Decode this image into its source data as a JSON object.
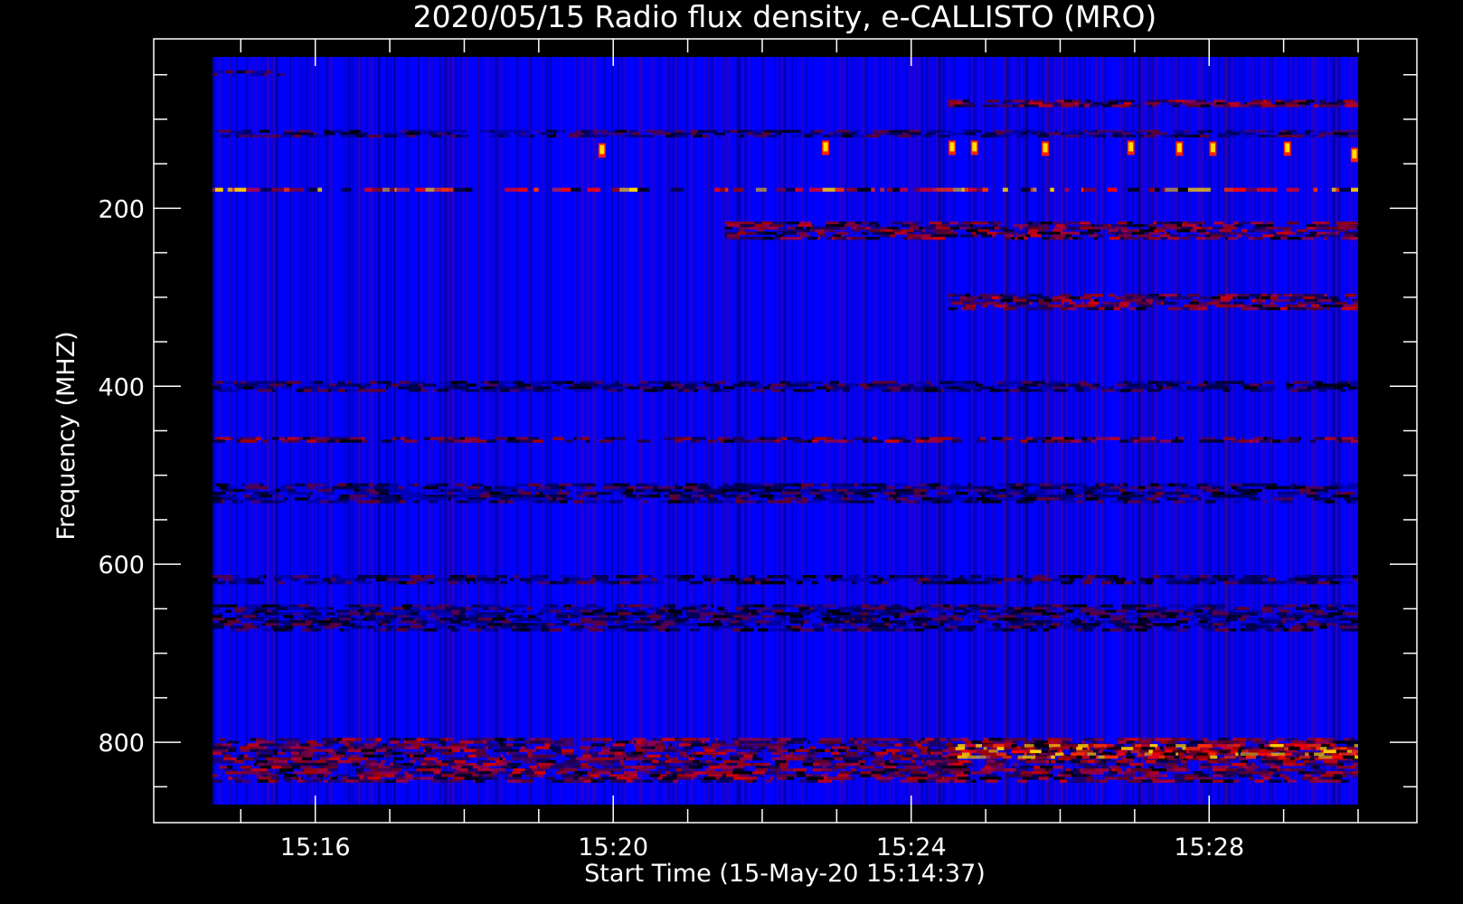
{
  "chart_data": {
    "type": "heatmap",
    "title": "2020/05/15  Radio flux density, e-CALLISTO (MRO)",
    "xlabel": "Start Time (15-May-20 15:14:37)",
    "ylabel": "Frequency (MHZ)",
    "x_tick_labels": [
      "15:16",
      "15:20",
      "15:24",
      "15:28"
    ],
    "x_major_ticks_min": [
      16,
      20,
      24,
      28
    ],
    "x_range_min": [
      14.62,
      30.0
    ],
    "y_tick_labels": [
      "200",
      "400",
      "600",
      "800"
    ],
    "y_major_ticks": [
      200,
      400,
      600,
      800
    ],
    "y_range": [
      30,
      870
    ],
    "y_inverted": true,
    "grid": false,
    "colormap": [
      "#000000",
      "#0000ff",
      "#ff0000",
      "#ffff00",
      "#ffffff"
    ],
    "background_color": "#0000ff",
    "bands": [
      {
        "freq": 48,
        "width": 6,
        "level": "low",
        "t0": 14.62,
        "t1": 15.6
      },
      {
        "freq": 82,
        "width": 8,
        "level": "mid",
        "t0": 24.5,
        "t1": 30.0
      },
      {
        "freq": 116,
        "width": 8,
        "level": "low",
        "t0": 14.62,
        "t1": 30.0
      },
      {
        "freq": 179,
        "width": 4,
        "level": "high",
        "t0": 14.62,
        "t1": 30.0
      },
      {
        "freq": 225,
        "width": 20,
        "level": "mid",
        "t0": 21.5,
        "t1": 30.0
      },
      {
        "freq": 305,
        "width": 18,
        "level": "mid",
        "t0": 24.5,
        "t1": 30.0
      },
      {
        "freq": 400,
        "width": 12,
        "level": "low",
        "t0": 14.62,
        "t1": 30.0
      },
      {
        "freq": 460,
        "width": 6,
        "level": "mid",
        "t0": 14.62,
        "t1": 30.0
      },
      {
        "freq": 520,
        "width": 22,
        "level": "low",
        "t0": 14.62,
        "t1": 30.0
      },
      {
        "freq": 617,
        "width": 10,
        "level": "low",
        "t0": 14.62,
        "t1": 30.0
      },
      {
        "freq": 660,
        "width": 30,
        "level": "low",
        "t0": 14.62,
        "t1": 30.0
      },
      {
        "freq": 820,
        "width": 50,
        "level": "mid",
        "t0": 14.62,
        "t1": 30.0
      },
      {
        "freq": 810,
        "width": 16,
        "level": "high",
        "t0": 24.5,
        "t1": 30.0
      }
    ],
    "bursts": [
      {
        "t": 19.85,
        "freq": 135
      },
      {
        "t": 22.85,
        "freq": 132
      },
      {
        "t": 24.55,
        "freq": 132
      },
      {
        "t": 24.85,
        "freq": 132
      },
      {
        "t": 25.8,
        "freq": 133
      },
      {
        "t": 26.95,
        "freq": 132
      },
      {
        "t": 27.6,
        "freq": 133
      },
      {
        "t": 28.05,
        "freq": 133
      },
      {
        "t": 29.05,
        "freq": 133
      },
      {
        "t": 29.95,
        "freq": 140
      }
    ]
  }
}
